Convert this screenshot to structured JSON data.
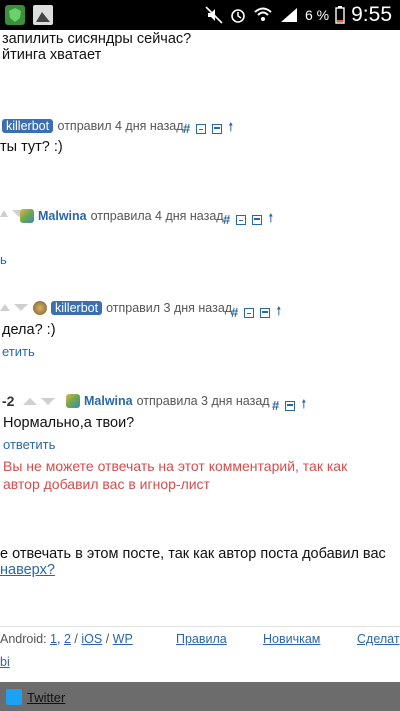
{
  "status": {
    "battery": "6 %",
    "time": "9:55"
  },
  "top": {
    "line1": "запилить сисяндры сейчас?",
    "line2": "йтинга хватает"
  },
  "comments": [
    {
      "user": "killerbot",
      "action": "отправил 4 дня назад",
      "hash": "#",
      "text": "ты тут? :)"
    },
    {
      "user": "Malwina",
      "action": "отправила 4 дня назад",
      "hash": "#",
      "reply": "ь"
    },
    {
      "user": "killerbot",
      "action": "отправил 3 дня назад",
      "hash": "#",
      "text": "дела? :)",
      "reply": "етить"
    },
    {
      "score": "-2",
      "user": "Malwina",
      "action": "отправила 3 дня назад",
      "hash": "#",
      "text": "Нормально,а твои?",
      "reply": "ответить",
      "warning_line1": "Вы не можете отвечать на этот комментарий, так как",
      "warning_line2": "автор добавил вас в игнор-лист"
    }
  ],
  "post_notice": {
    "line1": "е отвечать в этом посте, так как автор поста добавил вас",
    "link": "наверх?"
  },
  "footer": {
    "android_label": "Android:",
    "link_1": "1",
    "link_2": "2",
    "sep": "/",
    "ios": "iOS",
    "wp": "WP",
    "rules": "Правила",
    "newbies": "Новичкам",
    "make": "Сделат",
    "bi": "bi"
  },
  "bottom": {
    "twitter": "Twitter"
  },
  "colors": {
    "link": "#2a67a8",
    "warning": "#d64b4b",
    "badge": "#3b6fb0"
  }
}
